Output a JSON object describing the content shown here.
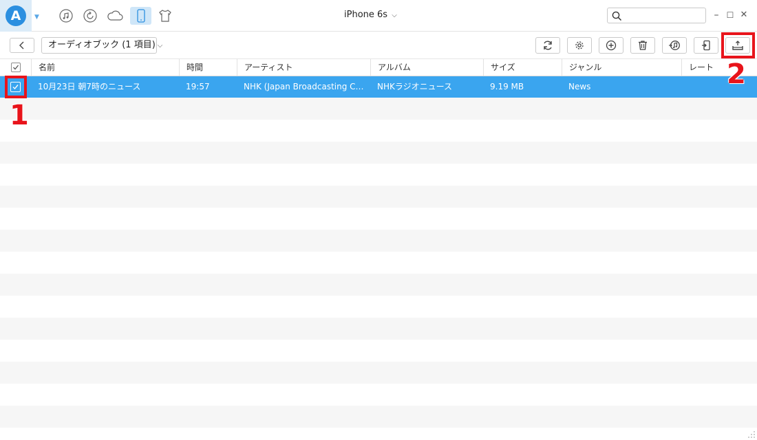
{
  "app": {
    "logo_letter": "A",
    "device_name": "iPhone 6s",
    "device_chevron": "⌄"
  },
  "nav_icons": [
    "music-icon",
    "restore-icon",
    "cloud-icon",
    "phone-icon",
    "tshirt-icon"
  ],
  "search": {
    "value": "",
    "placeholder": ""
  },
  "window_controls": {
    "minimize": "–",
    "maximize": "☐",
    "close": "✕"
  },
  "toolbar": {
    "category_dropdown": "オーディオブック (1 項目)",
    "buttons": [
      "refresh-icon",
      "settings-icon",
      "add-icon",
      "delete-icon",
      "to-itunes-icon",
      "to-computer-icon",
      "to-device-icon"
    ]
  },
  "table": {
    "columns": [
      {
        "key": "name",
        "label": "名前"
      },
      {
        "key": "time",
        "label": "時間"
      },
      {
        "key": "artist",
        "label": "アーティスト"
      },
      {
        "key": "album",
        "label": "アルバム"
      },
      {
        "key": "size",
        "label": "サイズ"
      },
      {
        "key": "genre",
        "label": "ジャンル"
      },
      {
        "key": "rating",
        "label": "レート"
      }
    ],
    "rows": [
      {
        "selected": true,
        "name": "10月23日 朝7時のニュース",
        "time": "19:57",
        "artist": "NHK (Japan Broadcasting Corp...",
        "album": "NHKラジオニュース",
        "size": "9.19 MB",
        "genre": "News",
        "rating": ""
      }
    ]
  },
  "annotations": [
    {
      "label": "1"
    },
    {
      "label": "2"
    }
  ],
  "colors": {
    "selection": "#3aa5ef",
    "callout": "#e8141b",
    "accent": "#2b8fe0"
  }
}
